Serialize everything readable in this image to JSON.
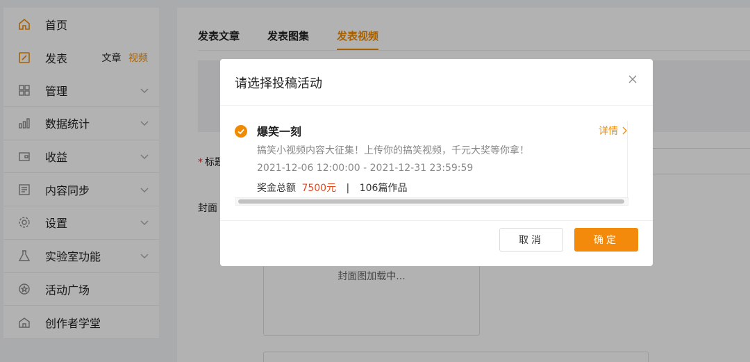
{
  "sidebar": {
    "items": [
      {
        "label": "首页",
        "icon": "home-icon"
      },
      {
        "label": "发表",
        "icon": "edit-icon",
        "sub": [
          "文章",
          "视频"
        ],
        "active_sub": "视频"
      },
      {
        "label": "管理",
        "icon": "grid-icon",
        "expandable": true
      },
      {
        "label": "数据统计",
        "icon": "bar-chart-icon",
        "expandable": true
      },
      {
        "label": "收益",
        "icon": "wallet-icon",
        "expandable": true
      },
      {
        "label": "内容同步",
        "icon": "document-icon",
        "expandable": true
      },
      {
        "label": "设置",
        "icon": "gear-icon",
        "expandable": true
      },
      {
        "label": "实验室功能",
        "icon": "flask-icon",
        "expandable": true
      },
      {
        "label": "活动广场",
        "icon": "star-badge-icon"
      },
      {
        "label": "创作者学堂",
        "icon": "school-icon"
      }
    ]
  },
  "main": {
    "tabs": [
      {
        "label": "发表文章"
      },
      {
        "label": "发表图集"
      },
      {
        "label": "发表视频",
        "active": true
      }
    ],
    "title_label": "标题",
    "cover_label": "封面",
    "cover_loading": "封面图加载中..."
  },
  "modal": {
    "title": "请选择投稿活动",
    "activity": {
      "name": "爆笑一刻",
      "description": "搞笑小视频内容大征集！上传你的搞笑视频，千元大奖等你拿！",
      "time_range": "2021-12-06 12:00:00 - 2021-12-31 23:59:59",
      "prize_label": "奖金总额",
      "prize_amount": "7500元",
      "works": "106篇作品",
      "detail_label": "详情"
    },
    "cancel_label": "取消",
    "ok_label": "确定"
  },
  "colors": {
    "accent": "#f08a00",
    "prize": "#e2471c",
    "primary_button": "#f48a0c"
  }
}
